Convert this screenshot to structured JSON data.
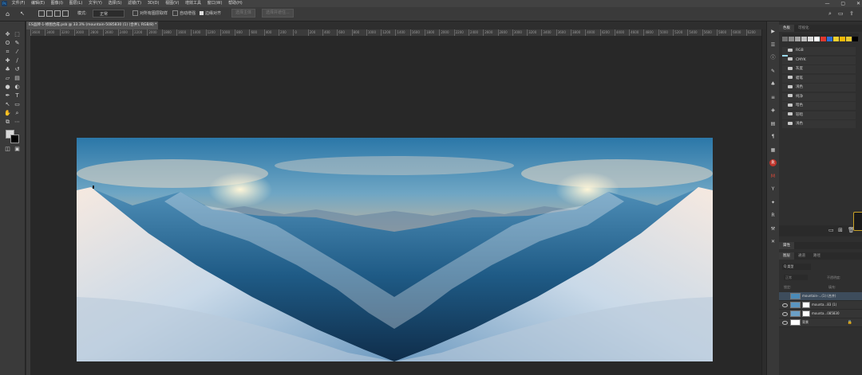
{
  "menubar": {
    "app_logo": "Ps",
    "items": [
      "文件(F)",
      "编辑(E)",
      "图像(I)",
      "图层(L)",
      "文字(Y)",
      "选择(S)",
      "滤镜(T)",
      "3D(D)",
      "视图(V)",
      "增效工具",
      "窗口(W)",
      "帮助(H)"
    ],
    "window_controls": [
      "—",
      "▢",
      "✕"
    ]
  },
  "options": {
    "mode_label": "模式:",
    "mode_value": "正常",
    "sample_all_label": "对所有图层取样",
    "auto_enhance_label": "自动增强",
    "edge_label": "边缘对齐",
    "btn1": "选择主体",
    "btn2": "选择并遮住..."
  },
  "document": {
    "tab_title": "ES品牌-1-修图合成.psb @ 33.3% (mountain-5085830 (1) (合并), RGB/8) *",
    "close": "×",
    "ruler_ticks": [
      "3600",
      "3400",
      "3200",
      "3000",
      "2800",
      "2600",
      "2400",
      "2200",
      "2000",
      "1800",
      "1600",
      "1400",
      "1200",
      "1000",
      "800",
      "600",
      "400",
      "200",
      "0",
      "200",
      "400",
      "600",
      "800",
      "1000",
      "1200",
      "1400",
      "1600",
      "1800",
      "2000",
      "2200",
      "2400",
      "2600",
      "2800",
      "3000",
      "3200",
      "3400",
      "3600",
      "3800",
      "4000",
      "4200",
      "4400",
      "4600",
      "4800",
      "5000",
      "5200",
      "5400",
      "5600",
      "5800",
      "6000",
      "6200"
    ]
  },
  "swatches": {
    "tabs": [
      "色板",
      "可视化"
    ],
    "colors": [
      "#6f6f6f",
      "#8a8a8a",
      "#a5a5a5",
      "#c0c0c0",
      "#dcdcdc",
      "#ffffff",
      "#e0382f",
      "#2d6fd8",
      "#f0d02f",
      "#f2b807",
      "#e8c82f",
      "#000000",
      "#9ad8f0"
    ],
    "groups": [
      "RGB",
      "CMYK",
      "灰度",
      "蜡笔",
      "浅色",
      "纯净",
      "暗色",
      "较暗",
      "浅色"
    ]
  },
  "layers": {
    "tabs": [
      "图层",
      "通道",
      "路径"
    ],
    "panel_title": "属性",
    "kind_label": "Q 类型",
    "blend_mode": "正常",
    "opacity_label": "不透明度:",
    "fill_label": "填充:",
    "lock_label": "锁定:",
    "rows": [
      {
        "name": "mountain-...(1) (合并)",
        "visible": false,
        "has_mask": false
      },
      {
        "name": "mounta...83 (1)",
        "visible": true,
        "has_mask": true
      },
      {
        "name": "mounta...085830",
        "visible": true,
        "has_mask": true
      },
      {
        "name": "背景",
        "visible": true,
        "has_mask": false,
        "locked": true
      }
    ]
  },
  "right_strip_icons": [
    "play-icon",
    "adjust-icon",
    "info-icon",
    "brush-settings-icon",
    "clone-source-icon",
    "properties-icon",
    "3d-icon",
    "libraries-icon",
    "paragraph-icon",
    "timeline-icon",
    "ra-plugin-icon",
    "im-plugin-icon",
    "yy-plugin-icon",
    "plugin-icon",
    "r-plugin-icon",
    "tool-preset-icon",
    "tools-icon"
  ]
}
